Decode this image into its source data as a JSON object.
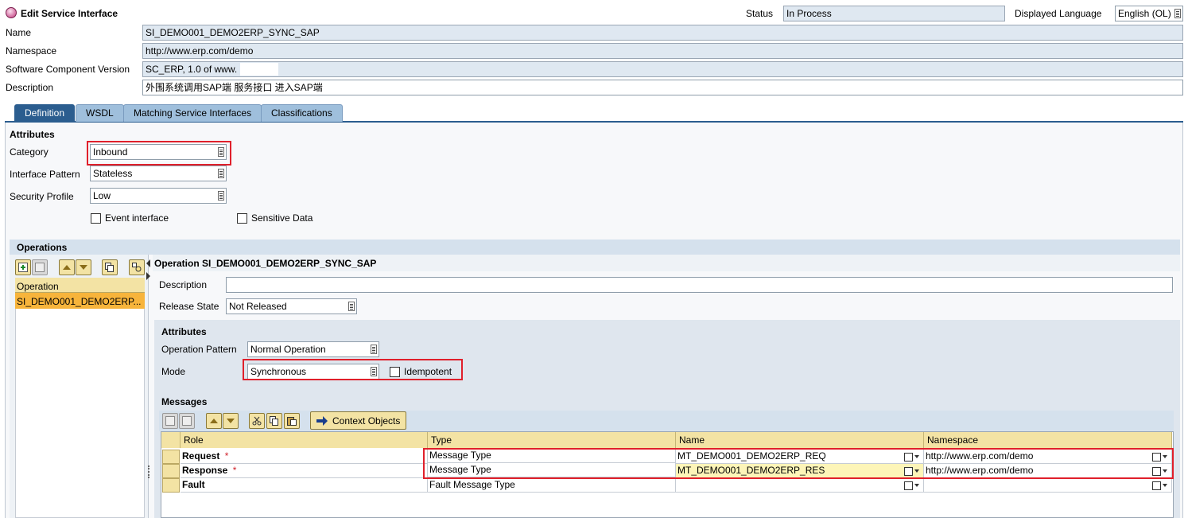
{
  "header": {
    "title": "Edit Service Interface",
    "status_label": "Status",
    "status_value": "In Process",
    "language_label": "Displayed Language",
    "language_value": "English (OL)"
  },
  "general": {
    "name_label": "Name",
    "name_value": "SI_DEMO001_DEMO2ERP_SYNC_SAP",
    "namespace_label": "Namespace",
    "namespace_value": "http://www.erp.com/demo",
    "swcv_label": "Software Component Version",
    "swcv_value": "SC_ERP, 1.0 of www.",
    "description_label": "Description",
    "description_value": "外围系统调用SAP端 服务接口 进入SAP端"
  },
  "tabs": [
    {
      "label": "Definition",
      "active": true
    },
    {
      "label": "WSDL",
      "active": false
    },
    {
      "label": "Matching Service Interfaces",
      "active": false
    },
    {
      "label": "Classifications",
      "active": false
    }
  ],
  "attributes": {
    "heading": "Attributes",
    "category_label": "Category",
    "category_value": "Inbound",
    "pattern_label": "Interface Pattern",
    "pattern_value": "Stateless",
    "security_label": "Security Profile",
    "security_value": "Low",
    "event_label": "Event interface",
    "sensitive_label": "Sensitive Data"
  },
  "operations": {
    "heading": "Operations",
    "list_header": "Operation",
    "items": [
      "SI_DEMO001_DEMO2ERP..."
    ],
    "detail_title": "Operation SI_DEMO001_DEMO2ERP_SYNC_SAP",
    "description_label": "Description",
    "description_value": "",
    "release_label": "Release State",
    "release_value": "Not Released",
    "attr_heading": "Attributes",
    "op_pattern_label": "Operation Pattern",
    "op_pattern_value": "Normal Operation",
    "mode_label": "Mode",
    "mode_value": "Synchronous",
    "idempotent_label": "Idempotent"
  },
  "messages": {
    "heading": "Messages",
    "context_button": "Context Objects",
    "columns": [
      "Role",
      "Type",
      "Name",
      "Namespace"
    ],
    "rows": [
      {
        "role": "Request",
        "required": "*",
        "type": "Message Type",
        "name": "MT_DEMO001_DEMO2ERP_REQ",
        "namespace": "http://www.erp.com/demo"
      },
      {
        "role": "Response",
        "required": "*",
        "type": "Message Type",
        "name": "MT_DEMO001_DEMO2ERP_RES",
        "namespace": "http://www.erp.com/demo"
      },
      {
        "role": "Fault",
        "required": "",
        "type": "Fault Message Type",
        "name": "",
        "namespace": ""
      }
    ]
  },
  "colors": {
    "accent_blue": "#2b5d8f",
    "field_bg": "#dfe8f1",
    "highlight_red": "#e0202b",
    "selection_yellow": "#f3e3a4"
  }
}
